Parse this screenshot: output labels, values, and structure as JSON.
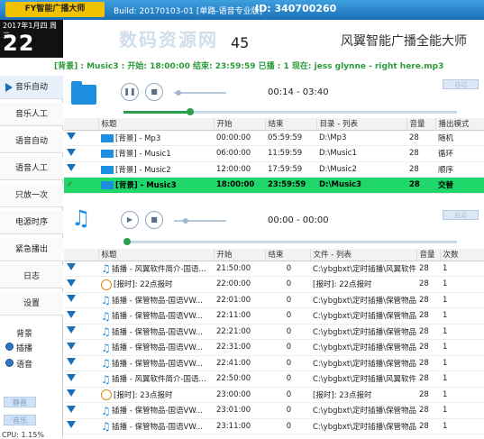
{
  "titlebar": {
    "app_name": "FY智能广播大师",
    "build": "Build: 20170103-01 [单路-语音专业版]",
    "id": "ID: 340700260"
  },
  "header": {
    "date": "2017年1月四 周三",
    "time": "22",
    "seconds": "45",
    "brand": "风翼智能广播全能大师",
    "watermark": "数码资源网"
  },
  "status_line": "[背景] : Music3 : 开始: 18:00:00 结束: 23:59:59 已播 : 1  现在: jess glynne - right here.mp3",
  "sidebar": {
    "items": [
      "音乐自动",
      "音乐人工",
      "语音自动",
      "语音人工",
      "只放一次",
      "电源时序",
      "紧急播出",
      "日志",
      "设置"
    ],
    "bg_label": "背景",
    "radio_1": "插播",
    "radio_2": "语音",
    "btn_1": "静音",
    "btn_2": "音乐",
    "cpu": "CPU: 1.15%"
  },
  "music_panel": {
    "time": "00:14 - 03:40",
    "auto_btn": "自动",
    "progress": 0.2,
    "columns": [
      "标题",
      "开始",
      "结束",
      "目录 - 列表",
      "音量",
      "播出模式"
    ],
    "rows": [
      {
        "title": "[背景] - Mp3",
        "start": "00:00:00",
        "end": "05:59:59",
        "dir": "D:\\Mp3",
        "vol": "28",
        "mode": "随机",
        "active": false
      },
      {
        "title": "[背景] - Music1",
        "start": "06:00:00",
        "end": "11:59:59",
        "dir": "D:\\Music1",
        "vol": "28",
        "mode": "循环",
        "active": false
      },
      {
        "title": "[背景] - Music2",
        "start": "12:00:00",
        "end": "17:59:59",
        "dir": "D:\\Music2",
        "vol": "28",
        "mode": "顺序",
        "active": false
      },
      {
        "title": "[背景] - Music3",
        "start": "18:00:00",
        "end": "23:59:59",
        "dir": "D:\\Music3",
        "vol": "28",
        "mode": "交替",
        "active": true
      }
    ]
  },
  "voice_panel": {
    "time": "00:00 - 00:00",
    "auto_btn": "自动",
    "columns": [
      "标题",
      "开始",
      "结束",
      "文件 - 列表",
      "音量",
      "次数"
    ],
    "rows": [
      {
        "icon": "note",
        "title": "插播 - 风翼软件简介-国语...",
        "start": "21:50:00",
        "end": "0",
        "file": "C:\\ybgbxt\\定时插播\\风翼软件",
        "vol": "28",
        "count": "1"
      },
      {
        "icon": "clock",
        "title": "[报时]: 22点报时",
        "start": "22:00:00",
        "end": "0",
        "file": "[报时]: 22点报时",
        "vol": "28",
        "count": "1"
      },
      {
        "icon": "note",
        "title": "插播 - 保管物品-国语VW...",
        "start": "22:01:00",
        "end": "0",
        "file": "C:\\ybgbxt\\定时插播\\保管物品",
        "vol": "28",
        "count": "1"
      },
      {
        "icon": "note",
        "title": "插播 - 保管物品-国语VW...",
        "start": "22:11:00",
        "end": "0",
        "file": "C:\\ybgbxt\\定时插播\\保管物品",
        "vol": "28",
        "count": "1"
      },
      {
        "icon": "note",
        "title": "插播 - 保管物品-国语VW...",
        "start": "22:21:00",
        "end": "0",
        "file": "C:\\ybgbxt\\定时插播\\保管物品",
        "vol": "28",
        "count": "1"
      },
      {
        "icon": "note",
        "title": "插播 - 保管物品-国语VW...",
        "start": "22:31:00",
        "end": "0",
        "file": "C:\\ybgbxt\\定时插播\\保管物品",
        "vol": "28",
        "count": "1"
      },
      {
        "icon": "note",
        "title": "插播 - 保管物品-国语VW...",
        "start": "22:41:00",
        "end": "0",
        "file": "C:\\ybgbxt\\定时插播\\保管物品",
        "vol": "28",
        "count": "1"
      },
      {
        "icon": "note",
        "title": "插播 - 风翼软件简介-国语...",
        "start": "22:50:00",
        "end": "0",
        "file": "C:\\ybgbxt\\定时插播\\风翼软件",
        "vol": "28",
        "count": "1"
      },
      {
        "icon": "clock",
        "title": "[报时]: 23点报时",
        "start": "23:00:00",
        "end": "0",
        "file": "[报时]: 23点报时",
        "vol": "28",
        "count": "1"
      },
      {
        "icon": "note",
        "title": "插播 - 保管物品-国语VW...",
        "start": "23:01:00",
        "end": "0",
        "file": "C:\\ybgbxt\\定时插播\\保管物品",
        "vol": "28",
        "count": "1"
      },
      {
        "icon": "note",
        "title": "插播 - 保管物品-国语VW...",
        "start": "23:11:00",
        "end": "0",
        "file": "C:\\ybgbxt\\定时插播\\保管物品",
        "vol": "28",
        "count": "1"
      }
    ]
  }
}
